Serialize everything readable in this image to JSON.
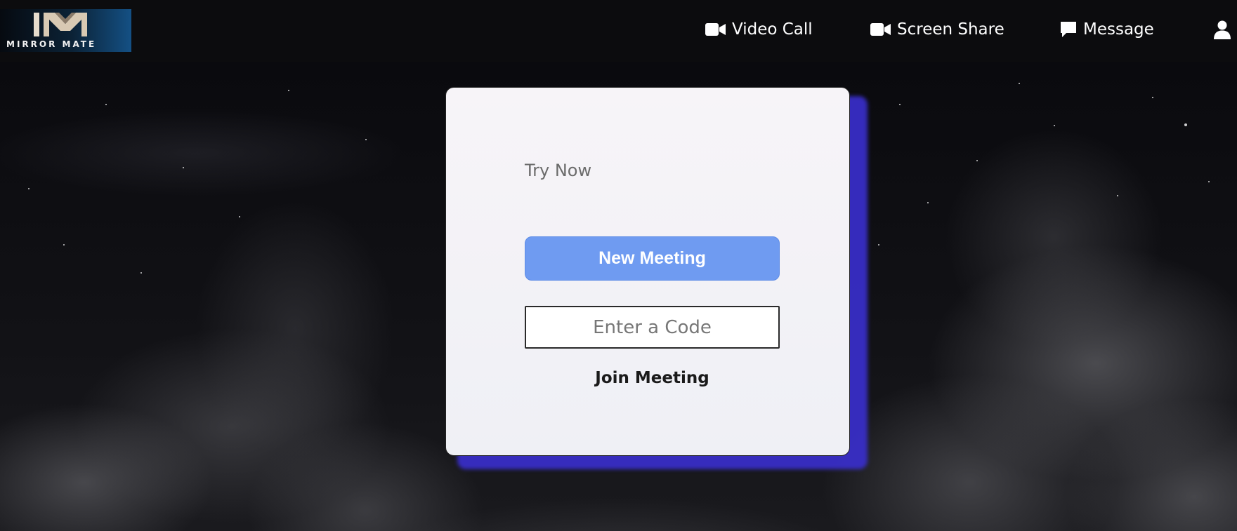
{
  "brand": {
    "logo_text": "MIRROR MATE",
    "logo_icon": "mm-logo-mark"
  },
  "nav": {
    "items": [
      {
        "label": "Video Call",
        "icon": "video-camera-icon"
      },
      {
        "label": "Screen Share",
        "icon": "video-camera-icon"
      },
      {
        "label": "Message",
        "icon": "chat-bubble-icon"
      }
    ],
    "profile_icon": "user-icon"
  },
  "card": {
    "heading": "Try Now",
    "new_meeting_label": "New Meeting",
    "code_placeholder": "Enter a Code",
    "join_label": "Join Meeting"
  },
  "colors": {
    "topbar": "#0c0c0e",
    "primary_button": "#6f9bf1",
    "card_glow": "#3a2fcf",
    "card_background": "#f5f3f7"
  }
}
